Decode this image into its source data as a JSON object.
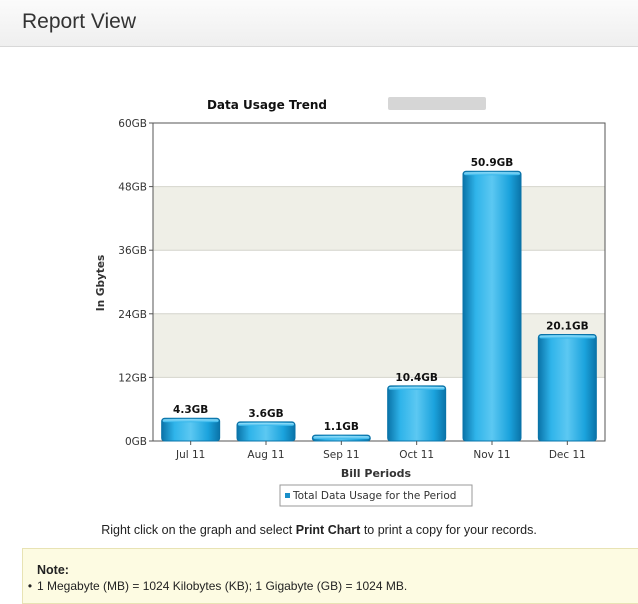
{
  "header": {
    "title": "Report View"
  },
  "chart_data": {
    "type": "bar",
    "title": "Data Usage Trend",
    "xlabel": "Bill Periods",
    "ylabel": "In Gbytes",
    "categories": [
      "Jul 11",
      "Aug 11",
      "Sep 11",
      "Oct 11",
      "Nov 11",
      "Dec 11"
    ],
    "series": [
      {
        "name": "Total Data Usage for the Period",
        "values": [
          4.3,
          3.6,
          1.1,
          10.4,
          50.9,
          20.1
        ],
        "labels": [
          "4.3GB",
          "3.6GB",
          "1.1GB",
          "10.4GB",
          "50.9GB",
          "20.1GB"
        ]
      }
    ],
    "ylim": [
      0,
      60
    ],
    "yticks": [
      0,
      12,
      24,
      36,
      48,
      60
    ],
    "ytick_labels": [
      "0GB",
      "12GB",
      "24GB",
      "36GB",
      "48GB",
      "60GB"
    ],
    "grid": true,
    "legend_position": "bottom",
    "colors": {
      "bar": "#1ba3dd",
      "bar_dark": "#0a73a8",
      "band": "#efefe7",
      "legend_marker": "#1a8fc9"
    }
  },
  "print_note": {
    "prefix": "Right click on the graph and select ",
    "bold": "Print Chart",
    "suffix": " to print a copy for your records."
  },
  "note": {
    "title": "Note:",
    "items": [
      "1 Megabyte (MB) = 1024 Kilobytes (KB); 1 Gigabyte (GB) = 1024 MB."
    ]
  }
}
